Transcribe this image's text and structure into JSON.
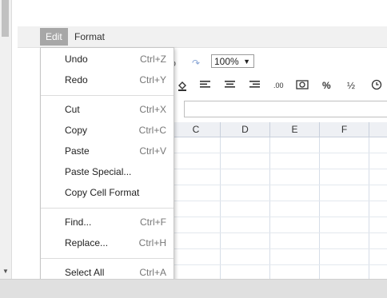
{
  "menubar": {
    "edit_label": "Edit",
    "format_label": "Format"
  },
  "toolbar": {
    "zoom_value": "100%",
    "percent_glyph": "%",
    "fraction_glyph": "½",
    "decimal_label": ".00"
  },
  "columns": [
    "C",
    "D",
    "E",
    "F"
  ],
  "edit_menu": {
    "items": [
      {
        "label": "Undo",
        "shortcut": "Ctrl+Z"
      },
      {
        "label": "Redo",
        "shortcut": "Ctrl+Y"
      },
      {
        "label": "Cut",
        "shortcut": "Ctrl+X"
      },
      {
        "label": "Copy",
        "shortcut": "Ctrl+C"
      },
      {
        "label": "Paste",
        "shortcut": "Ctrl+V"
      },
      {
        "label": "Paste Special...",
        "shortcut": ""
      },
      {
        "label": "Copy Cell Format",
        "shortcut": ""
      },
      {
        "label": "Find...",
        "shortcut": "Ctrl+F"
      },
      {
        "label": "Replace...",
        "shortcut": "Ctrl+H"
      },
      {
        "label": "Select All",
        "shortcut": "Ctrl+A"
      }
    ]
  }
}
